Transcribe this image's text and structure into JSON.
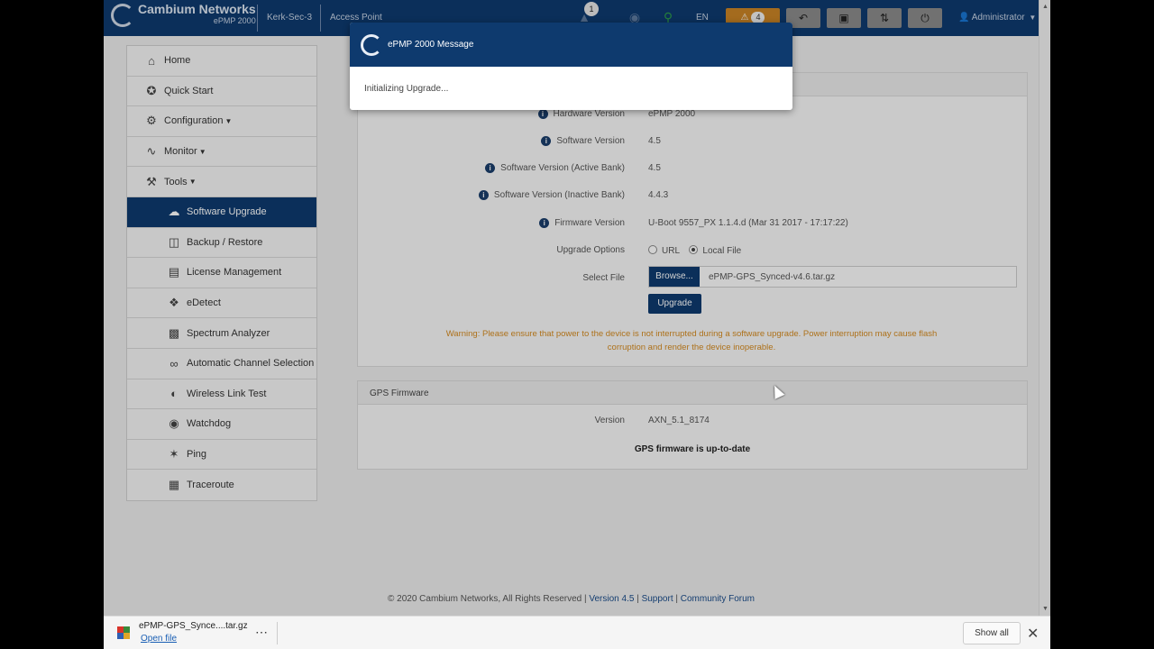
{
  "header": {
    "brand_name": "Cambium Networks",
    "brand_model": "ePMP 2000",
    "device_name": "Kerk-Sec-3",
    "mode": "Access Point",
    "notifications_count": "1",
    "language": "EN",
    "alerts_count": "4",
    "user": "Administrator",
    "icons": [
      "notification-icon",
      "globe-icon",
      "map-pin-icon",
      "undo-icon",
      "save-icon",
      "sync-icon",
      "power-icon",
      "user-icon"
    ]
  },
  "sidebar": {
    "items": [
      {
        "label": "Home",
        "icon": "home-icon"
      },
      {
        "label": "Quick Start",
        "icon": "run-icon"
      },
      {
        "label": "Configuration",
        "icon": "gear-icon"
      },
      {
        "label": "Monitor",
        "icon": "pulse-icon"
      },
      {
        "label": "Tools",
        "icon": "wrench-icon"
      },
      {
        "label": "Software Upgrade",
        "icon": "upgrade-icon"
      },
      {
        "label": "Backup / Restore",
        "icon": "backup-icon"
      },
      {
        "label": "License Management",
        "icon": "license-icon"
      },
      {
        "label": "eDetect",
        "icon": "edetect-icon"
      },
      {
        "label": "Spectrum Analyzer",
        "icon": "spectrum-icon"
      },
      {
        "label": "Automatic Channel Selection",
        "icon": "acs-icon"
      },
      {
        "label": "Wireless Link Test",
        "icon": "link-test-icon"
      },
      {
        "label": "Watchdog",
        "icon": "eye-icon"
      },
      {
        "label": "Ping",
        "icon": "ping-icon"
      },
      {
        "label": "Traceroute",
        "icon": "traceroute-icon"
      }
    ]
  },
  "upgrade": {
    "hardware_version_label": "Hardware Version",
    "hardware_version": "ePMP 2000",
    "software_version_label": "Software Version",
    "software_version": "4.5",
    "active_bank_label": "Software Version (Active Bank)",
    "active_bank": "4.5",
    "inactive_bank_label": "Software Version (Inactive Bank)",
    "inactive_bank": "4.4.3",
    "firmware_version_label": "Firmware Version",
    "firmware_version": "U-Boot 9557_PX 1.1.4.d (Mar 31 2017 - 17:17:22)",
    "upgrade_options_label": "Upgrade Options",
    "option_url": "URL",
    "option_local": "Local File",
    "select_file_label": "Select File",
    "browse_label": "Browse...",
    "file_name": "ePMP-GPS_Synced-v4.6.tar.gz",
    "upgrade_button": "Upgrade",
    "warning_line1": "Warning: Please ensure that power to the device is not interrupted during a software upgrade. Power interruption may cause flash",
    "warning_line2": "corruption and render the device inoperable."
  },
  "gps": {
    "title": "GPS Firmware",
    "version_label": "Version",
    "version": "AXN_5.1_8174",
    "status": "GPS firmware is up-to-date"
  },
  "footer": {
    "copyright": "© 2020 Cambium Networks, All Rights Reserved |",
    "version": "Version 4.5",
    "support": "Support",
    "forum": "Community Forum"
  },
  "modal": {
    "title": "ePMP 2000 Message",
    "message": "Initializing Upgrade..."
  },
  "download_bar": {
    "file_name": "ePMP-GPS_Synce....tar.gz",
    "open_label": "Open file",
    "show_all": "Show all"
  },
  "colors": {
    "brand_blue": "#0e3a6e",
    "warning_orange": "#d48a20",
    "alert_orange": "#c98325"
  }
}
